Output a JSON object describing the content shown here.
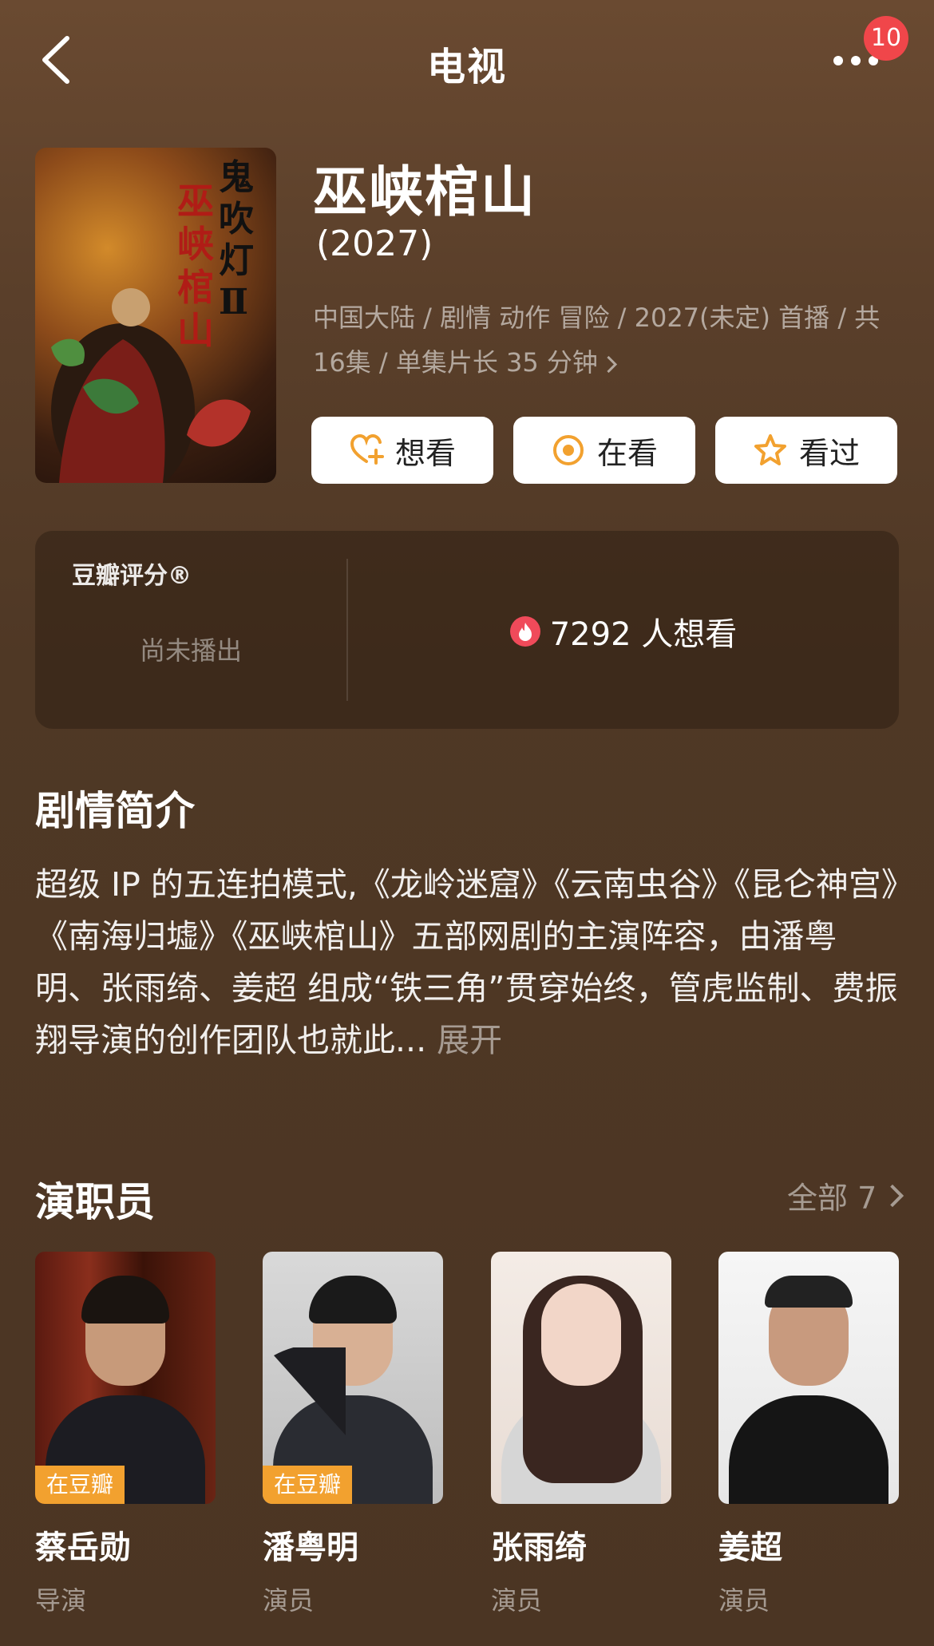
{
  "header": {
    "title": "电视",
    "badge": "10"
  },
  "show": {
    "title": "巫峡棺山",
    "year": "(2027)",
    "meta": "中国大陆 / 剧情 动作 冒险 / 2027(未定) 首播 / 共16集 / 单集片长 35 分钟",
    "poster_text": [
      "鬼吹灯Ⅱ",
      "巫峡棺山"
    ]
  },
  "actions": [
    {
      "label": "想看",
      "icon": "heart-plus-icon"
    },
    {
      "label": "在看",
      "icon": "target-icon"
    },
    {
      "label": "看过",
      "icon": "star-icon"
    }
  ],
  "rating": {
    "label": "豆瓣评分®",
    "status": "尚未播出",
    "want_count": "7292 人想看"
  },
  "synopsis": {
    "title": "剧情简介",
    "text": "超级 IP 的五连拍模式,《龙岭迷窟》《云南虫谷》《昆仑神宫》《南海归墟》《巫峡棺山》五部网剧的主演阵容，由潘粤明、张雨绮、姜超 组成“铁三角”贯穿始终，管虎监制、费振翔导演的创作团队也就此... ",
    "expand": "展开"
  },
  "cast": {
    "title": "演职员",
    "all": "全部 7",
    "members": [
      {
        "name": "蔡岳勋",
        "role": "导演",
        "tag": "在豆瓣"
      },
      {
        "name": "潘粤明",
        "role": "演员",
        "tag": "在豆瓣"
      },
      {
        "name": "张雨绮",
        "role": "演员",
        "tag": ""
      },
      {
        "name": "姜超",
        "role": "演员",
        "tag": ""
      }
    ]
  },
  "colors": {
    "accent": "#f2a12f",
    "badge": "#f0464a",
    "background": "#4f3825"
  }
}
